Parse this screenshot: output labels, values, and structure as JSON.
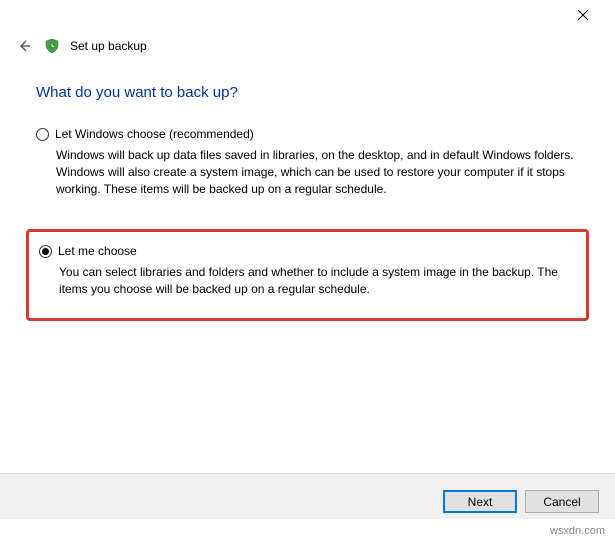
{
  "window": {
    "title": "Set up backup"
  },
  "page": {
    "heading": "What do you want to back up?"
  },
  "options": [
    {
      "label": "Let Windows choose (recommended)",
      "description": "Windows will back up data files saved in libraries, on the desktop, and in default Windows folders. Windows will also create a system image, which can be used to restore your computer if it stops working. These items will be backed up on a regular schedule.",
      "selected": false
    },
    {
      "label": "Let me choose",
      "description": "You can select libraries and folders and whether to include a system image in the backup. The items you choose will be backed up on a regular schedule.",
      "selected": true
    }
  ],
  "buttons": {
    "next": "Next",
    "cancel": "Cancel"
  },
  "watermark": "wsxdn.com"
}
